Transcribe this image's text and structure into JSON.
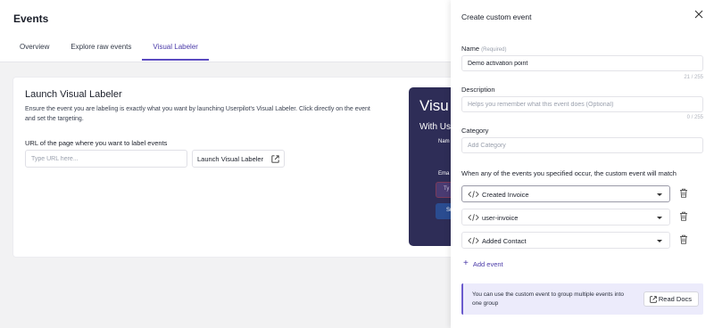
{
  "page": {
    "title": "Events",
    "tabs": [
      {
        "label": "Overview"
      },
      {
        "label": "Explore raw events"
      },
      {
        "label": "Visual Labeler"
      }
    ]
  },
  "card": {
    "title": "Launch Visual Labeler",
    "description": "Ensure the event you are labeling is exactly what you want by launching Userpilot's Visual Labeler. Click directly on the event and set the targeting.",
    "url_label": "URL of the page where you want to label events",
    "url_placeholder": "Type URL here...",
    "launch_label": "Launch Visual Labeler"
  },
  "illustration": {
    "big": "Visu",
    "sub": "With Us",
    "label1": "Nam",
    "label2": "Ema",
    "field": "Ty",
    "button": "Su"
  },
  "drawer": {
    "title": "Create custom event",
    "name_label": "Name",
    "name_required": "(Required)",
    "name_value": "Demo activation point",
    "name_counter": "21 / 255",
    "description_label": "Description",
    "description_placeholder": "Helps you remember what this event does (Optional)",
    "description_counter": "0 / 255",
    "category_label": "Category",
    "category_placeholder": "Add Category",
    "match_text": "When any of the events you specified occur, the custom event will match",
    "events": [
      {
        "label": "Created Invoice"
      },
      {
        "label": "user-invoice"
      },
      {
        "label": "Added Contact"
      }
    ],
    "add_event_label": "Add event",
    "info_text": "You can use the custom event to group multiple events into one group",
    "docs_label": "Read Docs"
  },
  "colors": {
    "accent": "#5a4ac0",
    "info_bg": "#ecebfb",
    "illustration_bg": "#2e2d57"
  }
}
